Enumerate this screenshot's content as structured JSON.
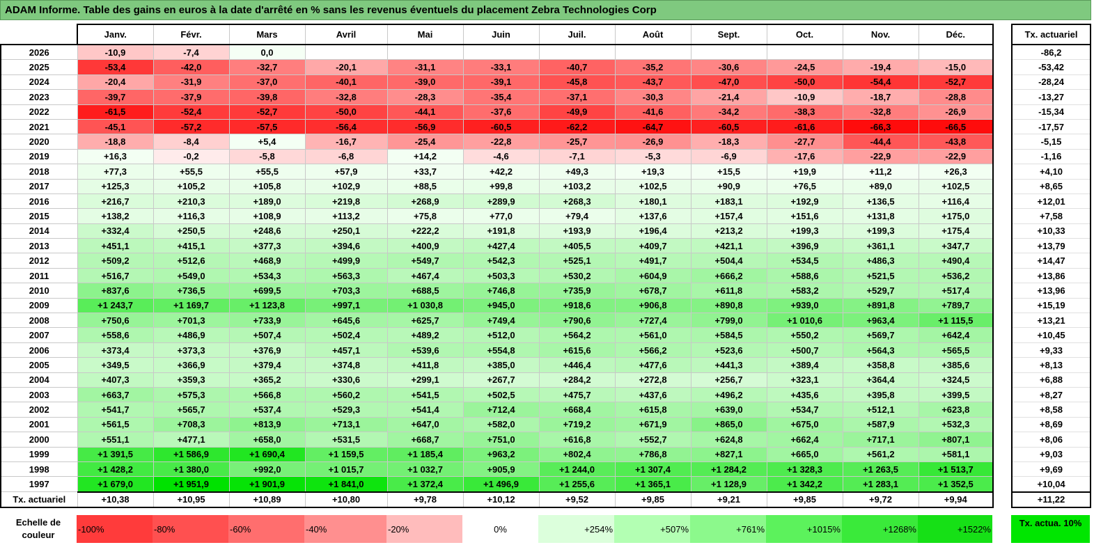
{
  "title": "ADAM Informe. Table des gains en euros à la date d'arrêté en % sans les revenus éventuels du placement Zebra Technologies Corp",
  "months": [
    "Janv.",
    "Févr.",
    "Mars",
    "Avril",
    "Mai",
    "Juin",
    "Juil.",
    "Août",
    "Sept.",
    "Oct.",
    "Nov.",
    "Déc."
  ],
  "side_header": "Tx. actuariel",
  "rows": [
    {
      "year": "2026",
      "values": [
        "-10,9",
        "-7,4",
        "0,0",
        "",
        "",
        "",
        "",
        "",
        "",
        "",
        "",
        ""
      ],
      "rate": "-86,2"
    },
    {
      "year": "2025",
      "values": [
        "-53,4",
        "-42,0",
        "-32,7",
        "-20,1",
        "-31,1",
        "-33,1",
        "-40,7",
        "-35,2",
        "-30,6",
        "-24,5",
        "-19,4",
        "-15,0"
      ],
      "rate": "-53,42"
    },
    {
      "year": "2024",
      "values": [
        "-20,4",
        "-31,9",
        "-37,0",
        "-40,1",
        "-39,0",
        "-39,1",
        "-45,8",
        "-43,7",
        "-47,0",
        "-50,0",
        "-54,4",
        "-52,7"
      ],
      "rate": "-28,24"
    },
    {
      "year": "2023",
      "values": [
        "-39,7",
        "-37,9",
        "-39,8",
        "-32,8",
        "-28,3",
        "-35,4",
        "-37,1",
        "-30,3",
        "-21,4",
        "-10,9",
        "-18,7",
        "-28,8"
      ],
      "rate": "-13,27"
    },
    {
      "year": "2022",
      "values": [
        "-61,5",
        "-52,4",
        "-52,7",
        "-50,0",
        "-44,1",
        "-37,6",
        "-49,9",
        "-41,6",
        "-34,2",
        "-38,3",
        "-32,8",
        "-26,9"
      ],
      "rate": "-15,34"
    },
    {
      "year": "2021",
      "values": [
        "-45,1",
        "-57,2",
        "-57,5",
        "-56,4",
        "-56,9",
        "-60,5",
        "-62,2",
        "-64,7",
        "-60,5",
        "-61,6",
        "-66,3",
        "-66,5"
      ],
      "rate": "-17,57"
    },
    {
      "year": "2020",
      "values": [
        "-18,8",
        "-8,4",
        "+5,4",
        "-16,7",
        "-25,4",
        "-22,8",
        "-25,7",
        "-26,9",
        "-18,3",
        "-27,7",
        "-44,4",
        "-43,8"
      ],
      "rate": "-5,15"
    },
    {
      "year": "2019",
      "values": [
        "+16,3",
        "-0,2",
        "-5,8",
        "-6,8",
        "+14,2",
        "-4,6",
        "-7,1",
        "-5,3",
        "-6,9",
        "-17,6",
        "-22,9",
        "-22,9"
      ],
      "rate": "-1,16"
    },
    {
      "year": "2018",
      "values": [
        "+77,3",
        "+55,5",
        "+55,5",
        "+57,9",
        "+33,7",
        "+42,2",
        "+49,3",
        "+19,3",
        "+15,5",
        "+19,9",
        "+11,2",
        "+26,3"
      ],
      "rate": "+4,10"
    },
    {
      "year": "2017",
      "values": [
        "+125,3",
        "+105,2",
        "+105,8",
        "+102,9",
        "+88,5",
        "+99,8",
        "+103,2",
        "+102,5",
        "+90,9",
        "+76,5",
        "+89,0",
        "+102,5"
      ],
      "rate": "+8,65"
    },
    {
      "year": "2016",
      "values": [
        "+216,7",
        "+210,3",
        "+189,0",
        "+219,8",
        "+268,9",
        "+289,9",
        "+268,3",
        "+180,1",
        "+183,1",
        "+192,9",
        "+136,5",
        "+116,4"
      ],
      "rate": "+12,01"
    },
    {
      "year": "2015",
      "values": [
        "+138,2",
        "+116,3",
        "+108,9",
        "+113,2",
        "+75,8",
        "+77,0",
        "+79,4",
        "+137,6",
        "+157,4",
        "+151,6",
        "+131,8",
        "+175,0"
      ],
      "rate": "+7,58"
    },
    {
      "year": "2014",
      "values": [
        "+332,4",
        "+250,5",
        "+248,6",
        "+250,1",
        "+222,2",
        "+191,8",
        "+193,9",
        "+196,4",
        "+213,2",
        "+199,3",
        "+199,3",
        "+175,4"
      ],
      "rate": "+10,33"
    },
    {
      "year": "2013",
      "values": [
        "+451,1",
        "+415,1",
        "+377,3",
        "+394,6",
        "+400,9",
        "+427,4",
        "+405,5",
        "+409,7",
        "+421,1",
        "+396,9",
        "+361,1",
        "+347,7"
      ],
      "rate": "+13,79"
    },
    {
      "year": "2012",
      "values": [
        "+509,2",
        "+512,6",
        "+468,9",
        "+499,9",
        "+549,7",
        "+542,3",
        "+525,1",
        "+491,7",
        "+504,4",
        "+534,5",
        "+486,3",
        "+490,4"
      ],
      "rate": "+14,47"
    },
    {
      "year": "2011",
      "values": [
        "+516,7",
        "+549,0",
        "+534,3",
        "+563,3",
        "+467,4",
        "+503,3",
        "+530,2",
        "+604,9",
        "+666,2",
        "+588,6",
        "+521,5",
        "+536,2"
      ],
      "rate": "+13,86"
    },
    {
      "year": "2010",
      "values": [
        "+837,6",
        "+736,5",
        "+699,5",
        "+703,3",
        "+688,5",
        "+746,8",
        "+735,9",
        "+678,7",
        "+611,8",
        "+583,2",
        "+529,7",
        "+517,4"
      ],
      "rate": "+13,96"
    },
    {
      "year": "2009",
      "values": [
        "+1 243,7",
        "+1 169,7",
        "+1 123,8",
        "+997,1",
        "+1 030,8",
        "+945,0",
        "+918,6",
        "+906,8",
        "+890,8",
        "+939,0",
        "+891,8",
        "+789,7"
      ],
      "rate": "+15,19"
    },
    {
      "year": "2008",
      "values": [
        "+750,6",
        "+701,3",
        "+733,9",
        "+645,6",
        "+625,7",
        "+749,4",
        "+790,6",
        "+727,4",
        "+799,0",
        "+1 010,6",
        "+963,4",
        "+1 115,5"
      ],
      "rate": "+13,21"
    },
    {
      "year": "2007",
      "values": [
        "+558,6",
        "+486,9",
        "+507,4",
        "+502,4",
        "+489,2",
        "+512,0",
        "+564,2",
        "+561,0",
        "+584,5",
        "+550,2",
        "+569,7",
        "+642,4"
      ],
      "rate": "+10,45"
    },
    {
      "year": "2006",
      "values": [
        "+373,4",
        "+373,3",
        "+376,9",
        "+457,1",
        "+539,6",
        "+554,8",
        "+615,6",
        "+566,2",
        "+523,6",
        "+500,7",
        "+564,3",
        "+565,5"
      ],
      "rate": "+9,33"
    },
    {
      "year": "2005",
      "values": [
        "+349,5",
        "+366,9",
        "+379,4",
        "+374,8",
        "+411,8",
        "+385,0",
        "+446,4",
        "+477,6",
        "+441,3",
        "+389,4",
        "+358,8",
        "+385,6"
      ],
      "rate": "+8,13"
    },
    {
      "year": "2004",
      "values": [
        "+407,3",
        "+359,3",
        "+365,2",
        "+330,6",
        "+299,1",
        "+267,7",
        "+284,2",
        "+272,8",
        "+256,7",
        "+323,1",
        "+364,4",
        "+324,5"
      ],
      "rate": "+6,88"
    },
    {
      "year": "2003",
      "values": [
        "+663,7",
        "+575,3",
        "+566,8",
        "+560,2",
        "+541,5",
        "+502,5",
        "+475,7",
        "+437,6",
        "+496,2",
        "+435,6",
        "+395,8",
        "+399,5"
      ],
      "rate": "+8,27"
    },
    {
      "year": "2002",
      "values": [
        "+541,7",
        "+565,7",
        "+537,4",
        "+529,3",
        "+541,4",
        "+712,4",
        "+668,4",
        "+615,8",
        "+639,0",
        "+534,7",
        "+512,1",
        "+623,8"
      ],
      "rate": "+8,58"
    },
    {
      "year": "2001",
      "values": [
        "+561,5",
        "+708,3",
        "+813,9",
        "+713,1",
        "+647,0",
        "+582,0",
        "+719,2",
        "+671,9",
        "+865,0",
        "+675,0",
        "+587,9",
        "+532,3"
      ],
      "rate": "+8,69"
    },
    {
      "year": "2000",
      "values": [
        "+551,1",
        "+477,1",
        "+658,0",
        "+531,5",
        "+668,7",
        "+751,0",
        "+616,8",
        "+552,7",
        "+624,8",
        "+662,4",
        "+717,1",
        "+807,1"
      ],
      "rate": "+8,06"
    },
    {
      "year": "1999",
      "values": [
        "+1 391,5",
        "+1 586,9",
        "+1 690,4",
        "+1 159,5",
        "+1 185,4",
        "+963,2",
        "+802,4",
        "+786,8",
        "+827,1",
        "+665,0",
        "+561,2",
        "+581,1"
      ],
      "rate": "+9,03"
    },
    {
      "year": "1998",
      "values": [
        "+1 428,2",
        "+1 380,0",
        "+992,0",
        "+1 015,7",
        "+1 032,7",
        "+905,9",
        "+1 244,0",
        "+1 307,4",
        "+1 284,2",
        "+1 328,3",
        "+1 263,5",
        "+1 513,7"
      ],
      "rate": "+9,69"
    },
    {
      "year": "1997",
      "values": [
        "+1 679,0",
        "+1 951,9",
        "+1 901,9",
        "+1 841,0",
        "+1 372,4",
        "+1 496,9",
        "+1 255,6",
        "+1 365,1",
        "+1 128,9",
        "+1 342,2",
        "+1 283,1",
        "+1 352,5"
      ],
      "rate": "+10,04"
    }
  ],
  "footer_row": {
    "label": "Tx. actuariel",
    "values": [
      "+10,38",
      "+10,95",
      "+10,89",
      "+10,80",
      "+9,78",
      "+10,12",
      "+9,52",
      "+9,85",
      "+9,21",
      "+9,85",
      "+9,72",
      "+9,94"
    ],
    "rate": "+11,22"
  },
  "legend": {
    "label": "Echelle de couleur",
    "scale": [
      {
        "text": "-100%",
        "color": "#ff3b3b"
      },
      {
        "text": "-80%",
        "color": "#ff5050"
      },
      {
        "text": "-60%",
        "color": "#ff6e6e"
      },
      {
        "text": "-40%",
        "color": "#ff8f8f"
      },
      {
        "text": "-20%",
        "color": "#ffbcbc"
      },
      {
        "text": "0%",
        "color": "#ffffff"
      },
      {
        "text": "+254%",
        "color": "#dcffdc"
      },
      {
        "text": "+507%",
        "color": "#b3ffb3"
      },
      {
        "text": "+761%",
        "color": "#8cf98c"
      },
      {
        "text": "+1015%",
        "color": "#5cf25c"
      },
      {
        "text": "+1268%",
        "color": "#3aea3a"
      },
      {
        "text": "+1522%",
        "color": "#16e016"
      }
    ],
    "side_label": "Tx. actua. 10%",
    "side_color": "#00e600"
  }
}
